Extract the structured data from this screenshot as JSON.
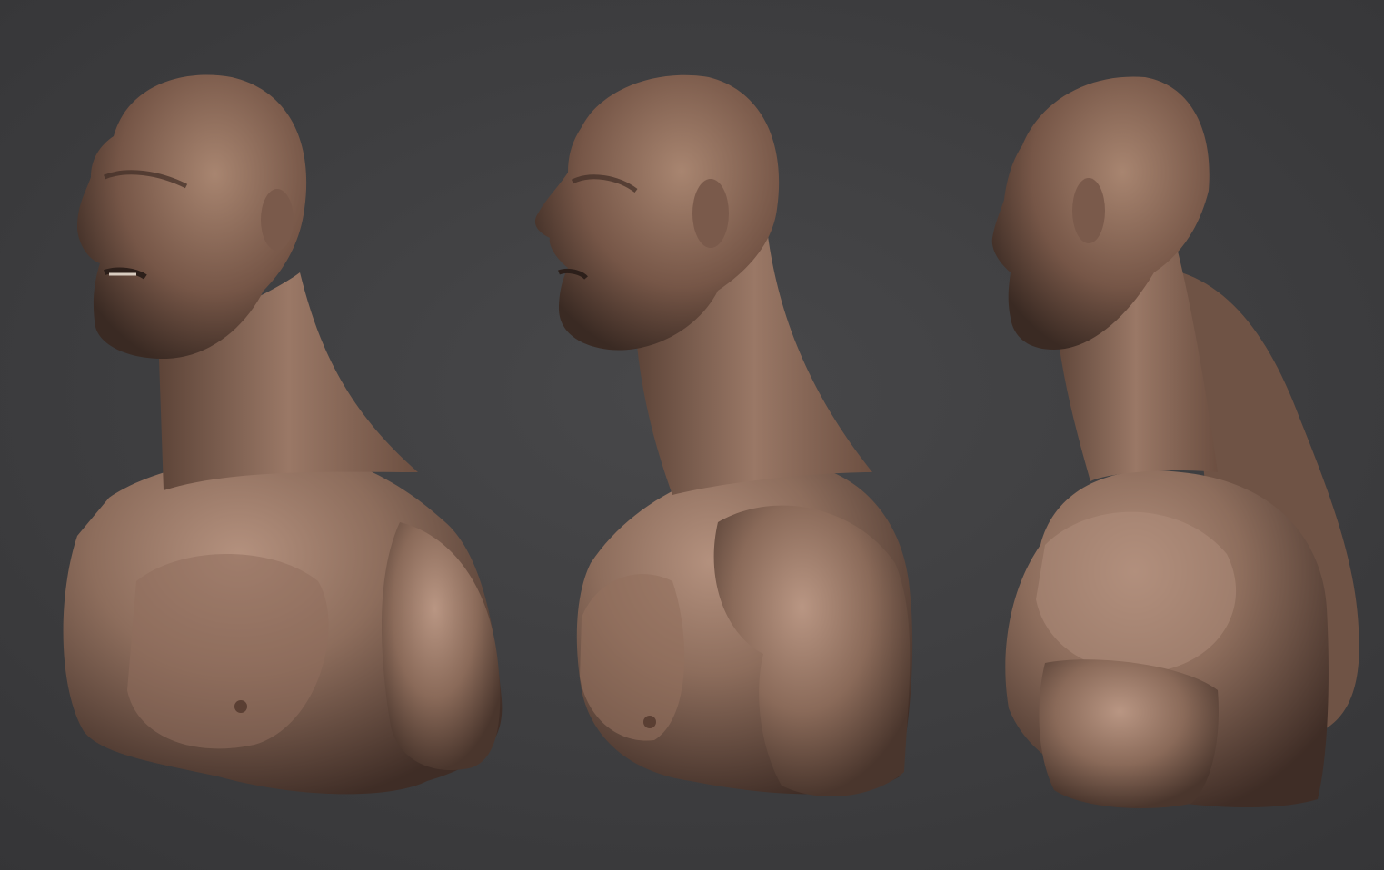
{
  "scene": {
    "background_color": "#3c3c3e",
    "background_gradient_center": "#48484a",
    "skin_base": "#8a6a5a",
    "skin_highlight": "#b4917e",
    "skin_shadow": "#3a2a24",
    "views": [
      {
        "name": "three-quarter-front",
        "icon": "bust-icon"
      },
      {
        "name": "side-profile",
        "icon": "bust-icon"
      },
      {
        "name": "three-quarter-back",
        "icon": "bust-icon"
      }
    ]
  }
}
